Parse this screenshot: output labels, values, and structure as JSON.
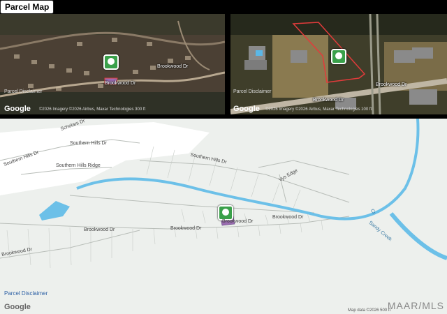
{
  "header": {
    "title": "Parcel Map"
  },
  "left_satellite": {
    "streets": [
      "Brookwood Dr",
      "Brookwood Dr"
    ],
    "disclaimer": "Parcel Disclaimer",
    "logo": "Google",
    "attribution": "©2026 Imagery ©2026 Airbus, Maxar Technologies 300 ft"
  },
  "right_satellite": {
    "streets": [
      "Brookwood Dr",
      "Brookwood Dr"
    ],
    "disclaimer": "Parcel Disclaimer",
    "logo": "Google",
    "attribution": "©2026 Imagery ©2026 Airbus, Maxar Technologies 100 ft"
  },
  "road_map": {
    "streets": {
      "scholars": "Scholars Dr",
      "southern_hills_upper": "Southern Hills Dr",
      "southern_hills_left": "Southern Hills Dr",
      "southern_hills_ridge": "Southern Hills Ridge",
      "southern_hills_mid": "Southern Hills Dr",
      "vys_edge": "Vys Edge",
      "brookwood_left": "Brookwood Dr",
      "brookwood_mid": "Brookwood Dr",
      "brookwood_center": "Brookwood Dr",
      "brookwood_right": "Brookwood Dr",
      "creek": "Cr",
      "creek2": "Sandy Creek"
    },
    "disclaimer": "Parcel Disclaimer",
    "logo": "Google",
    "attribution": "Map data ©2026 500 ft",
    "watermark": "MAAR/MLS"
  },
  "colors": {
    "pin": "#3aa04a",
    "parcel_outline": "#e23b3b",
    "river": "#6cc0e8",
    "parcel_fill": "#9a6cb0"
  },
  "icons": [
    "parcel-pin-icon",
    "parcel-pin-icon",
    "parcel-pin-icon"
  ]
}
